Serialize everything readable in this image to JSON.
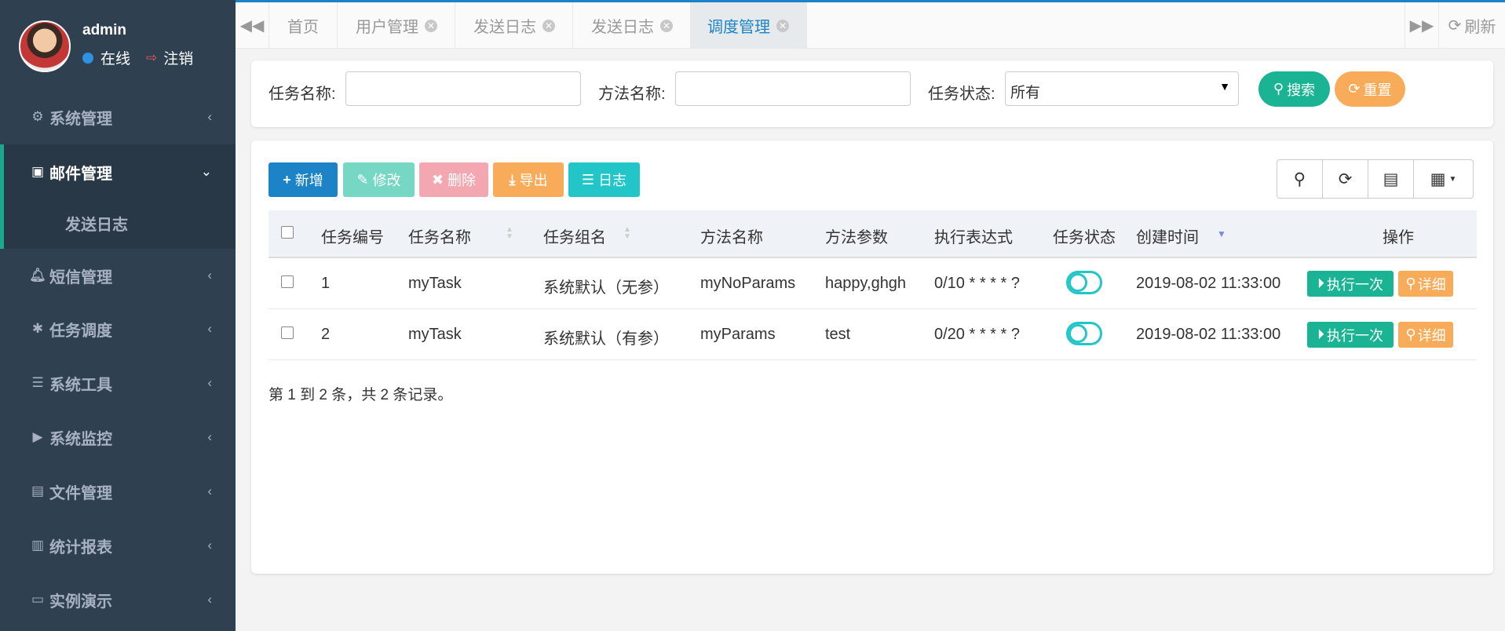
{
  "sidebar": {
    "profile": {
      "username": "admin",
      "status": "在线",
      "logout": "注销"
    },
    "items": [
      {
        "label": "系统管理",
        "icon": "gear-icon"
      },
      {
        "label": "邮件管理",
        "icon": "calendar-icon"
      },
      {
        "label": "短信管理",
        "icon": "bell-icon"
      },
      {
        "label": "任务调度",
        "icon": "asterisk-icon"
      },
      {
        "label": "系统工具",
        "icon": "bars-icon"
      },
      {
        "label": "系统监控",
        "icon": "video-icon"
      },
      {
        "label": "文件管理",
        "icon": "book-icon"
      },
      {
        "label": "统计报表",
        "icon": "bar-chart-icon"
      },
      {
        "label": "实例演示",
        "icon": "desktop-icon"
      }
    ],
    "subitem": "发送日志"
  },
  "tabs": {
    "items": [
      "首页",
      "用户管理",
      "发送日志",
      "发送日志",
      "调度管理"
    ],
    "active": "调度管理",
    "refresh": "刷新"
  },
  "search": {
    "task_name_label": "任务名称:",
    "task_name_value": "",
    "method_name_label": "方法名称:",
    "method_name_value": "",
    "status_label": "任务状态:",
    "status_value": "所有",
    "search_button": "搜索",
    "reset_button": "重置"
  },
  "toolbar": {
    "add": "新增",
    "edit": "修改",
    "delete": "删除",
    "export": "导出",
    "log": "日志"
  },
  "table": {
    "columns": [
      "任务编号",
      "任务名称",
      "任务组名",
      "方法名称",
      "方法参数",
      "执行表达式",
      "任务状态",
      "创建时间",
      "操作"
    ],
    "rows": [
      {
        "id": "1",
        "name": "myTask",
        "group": "系统默认（无参）",
        "method": "myNoParams",
        "params": "happy,ghgh",
        "cron": "0/10 * * * * ?",
        "created": "2019-08-02 11:33:00",
        "run": "执行一次",
        "detail": "详细"
      },
      {
        "id": "2",
        "name": "myTask",
        "group": "系统默认（有参）",
        "method": "myParams",
        "params": "test",
        "cron": "0/20 * * * * ?",
        "created": "2019-08-02 11:33:00",
        "run": "执行一次",
        "detail": "详细"
      }
    ],
    "summary": "第 1 到 2 条，共 2 条记录。"
  },
  "colors": {
    "sidebar_bg": "#2f4050",
    "primary": "#1c84c6",
    "success": "#1ab394",
    "info": "#23c6c8",
    "warning": "#f8ac59",
    "danger": "#ed5565"
  }
}
